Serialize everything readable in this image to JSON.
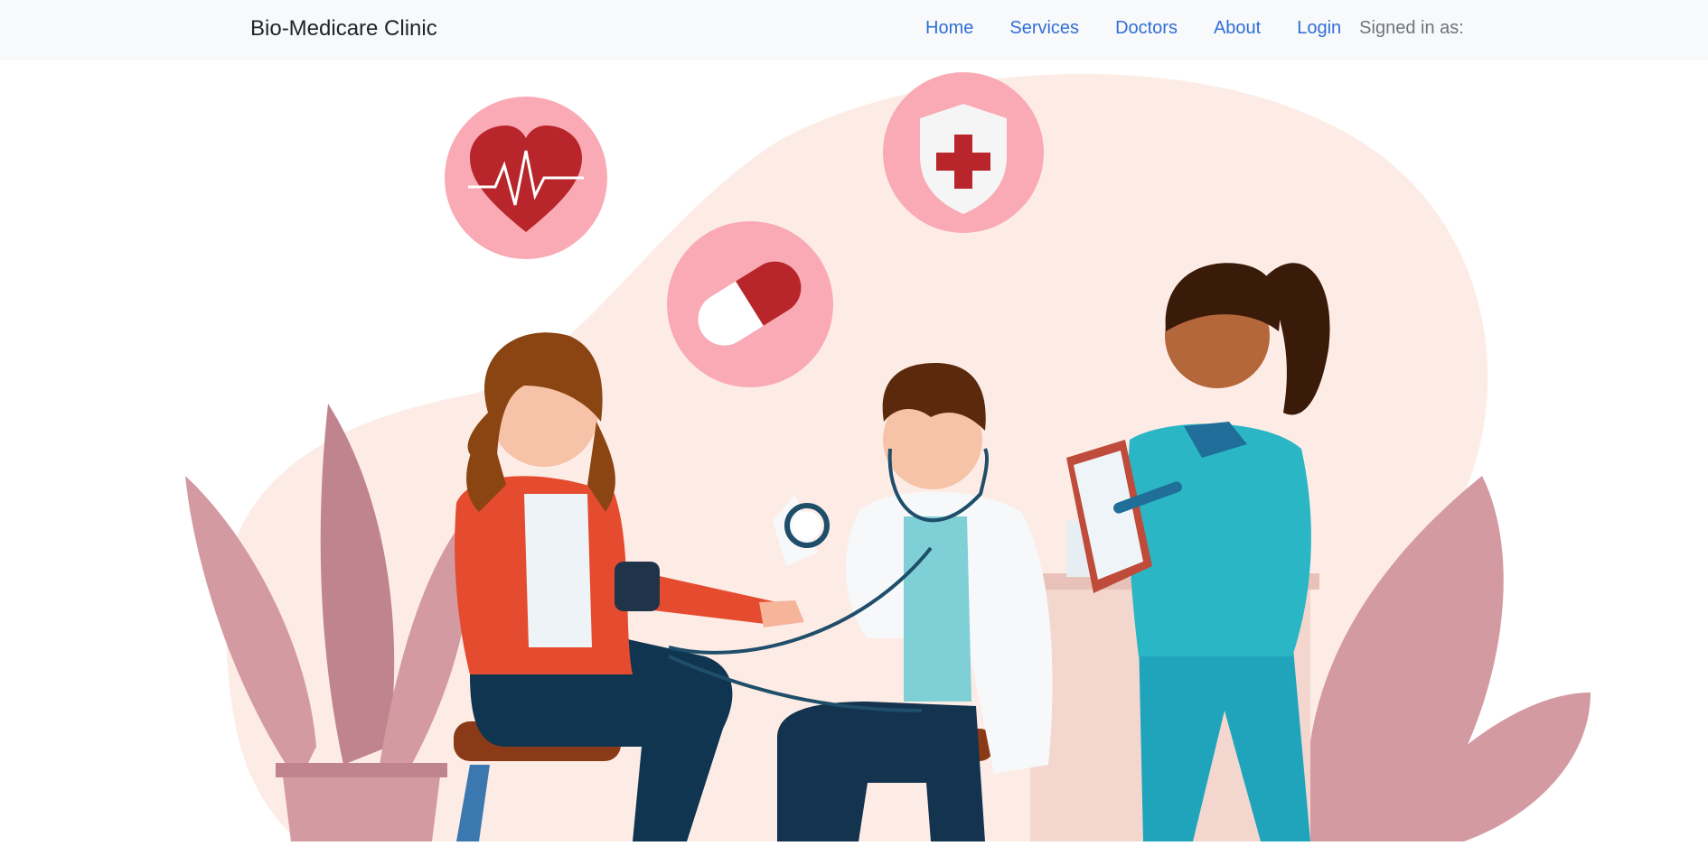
{
  "navbar": {
    "brand": "Bio-Medicare Clinic",
    "links": [
      {
        "label": "Home"
      },
      {
        "label": "Services"
      },
      {
        "label": "Doctors"
      },
      {
        "label": "About"
      },
      {
        "label": "Login"
      }
    ],
    "signed_in_text": "Signed in as:"
  },
  "hero": {
    "colors": {
      "blob": "#fdece6",
      "circle": "#f9aab4",
      "red": "#b8262b",
      "leaf": "#d49aa2",
      "teal": "#2bb6c5"
    }
  }
}
